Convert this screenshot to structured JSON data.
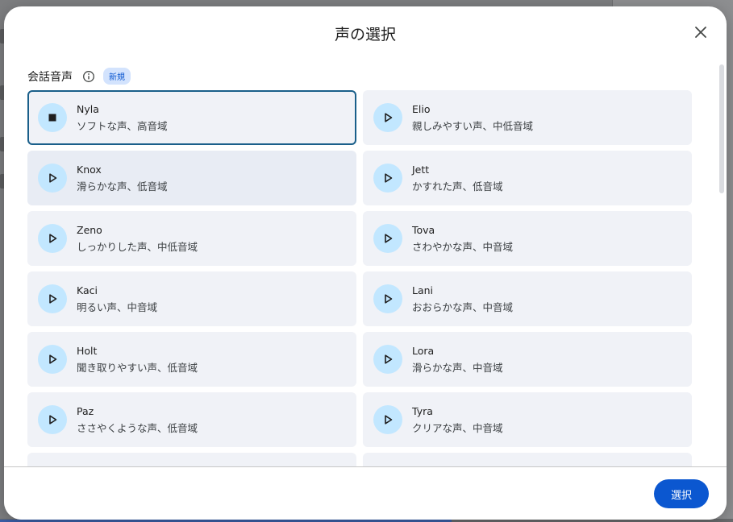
{
  "dialog": {
    "title": "声の選択",
    "section_title": "会話音声",
    "new_badge": "新規",
    "select_label": "選択"
  },
  "voices": [
    {
      "name": "Nyla",
      "desc": "ソフトな声、高音域",
      "state": "playing"
    },
    {
      "name": "Elio",
      "desc": "親しみやすい声、中低音域",
      "state": "idle"
    },
    {
      "name": "Knox",
      "desc": "滑らかな声、低音域",
      "state": "idle"
    },
    {
      "name": "Jett",
      "desc": "かすれた声、低音域",
      "state": "idle"
    },
    {
      "name": "Zeno",
      "desc": "しっかりした声、中低音域",
      "state": "idle"
    },
    {
      "name": "Tova",
      "desc": "さわやかな声、中音域",
      "state": "idle"
    },
    {
      "name": "Kaci",
      "desc": "明るい声、中音域",
      "state": "idle"
    },
    {
      "name": "Lani",
      "desc": "おおらかな声、中音域",
      "state": "idle"
    },
    {
      "name": "Holt",
      "desc": "聞き取りやすい声、低音域",
      "state": "idle"
    },
    {
      "name": "Lora",
      "desc": "滑らかな声、中音域",
      "state": "idle"
    },
    {
      "name": "Paz",
      "desc": "ささやくような声、低音域",
      "state": "idle"
    },
    {
      "name": "Tyra",
      "desc": "クリアな声、中音域",
      "state": "idle"
    }
  ],
  "colors": {
    "accent": "#0b57d0",
    "play_circle": "#c2e7ff",
    "card_bg": "#f0f2f7",
    "selected_border": "#1a5f8a"
  }
}
